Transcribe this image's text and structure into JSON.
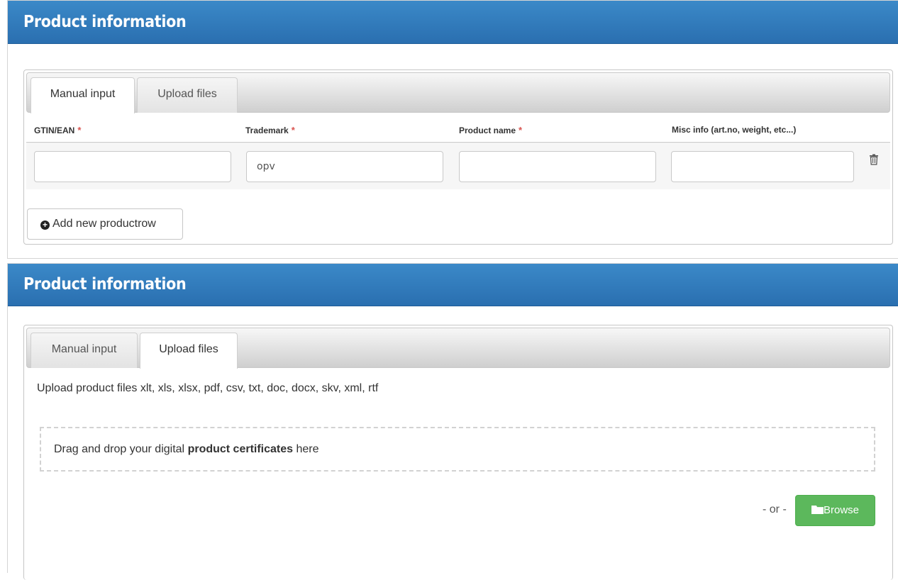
{
  "panels": [
    {
      "title": "Product information",
      "tabs": [
        {
          "label": "Manual input",
          "active": true
        },
        {
          "label": "Upload files",
          "active": false
        }
      ],
      "columns": [
        {
          "label": "GTIN/EAN",
          "required_mark": "*"
        },
        {
          "label": "Trademark",
          "required_mark": "*"
        },
        {
          "label": "Product name",
          "required_mark": "*"
        },
        {
          "label": "Misc info (art.no, weight, etc...)"
        }
      ],
      "row": {
        "gtin": "",
        "trademark": "opv",
        "product_name": "",
        "misc": "",
        "delete_icon": "trash-icon"
      },
      "add_row_label": "Add new productrow",
      "add_row_icon": "plus-circle-icon"
    },
    {
      "title": "Product information",
      "tabs": [
        {
          "label": "Manual input",
          "active": false
        },
        {
          "label": "Upload files",
          "active": true
        }
      ],
      "upload_text": "Upload product files xlt, xls, xlsx, pdf, csv, txt, doc, docx, skv, xml, rtf",
      "dropzone": {
        "prefix": "Drag and drop your digital ",
        "bold": "product certificates",
        "suffix": " here"
      },
      "or_text": "- or -",
      "browse_label": "Browse",
      "browse_icon": "folder-open-icon"
    }
  ],
  "colors": {
    "header": "#2f7abd",
    "required": "#d9534f",
    "browse": "#5cb85c"
  }
}
